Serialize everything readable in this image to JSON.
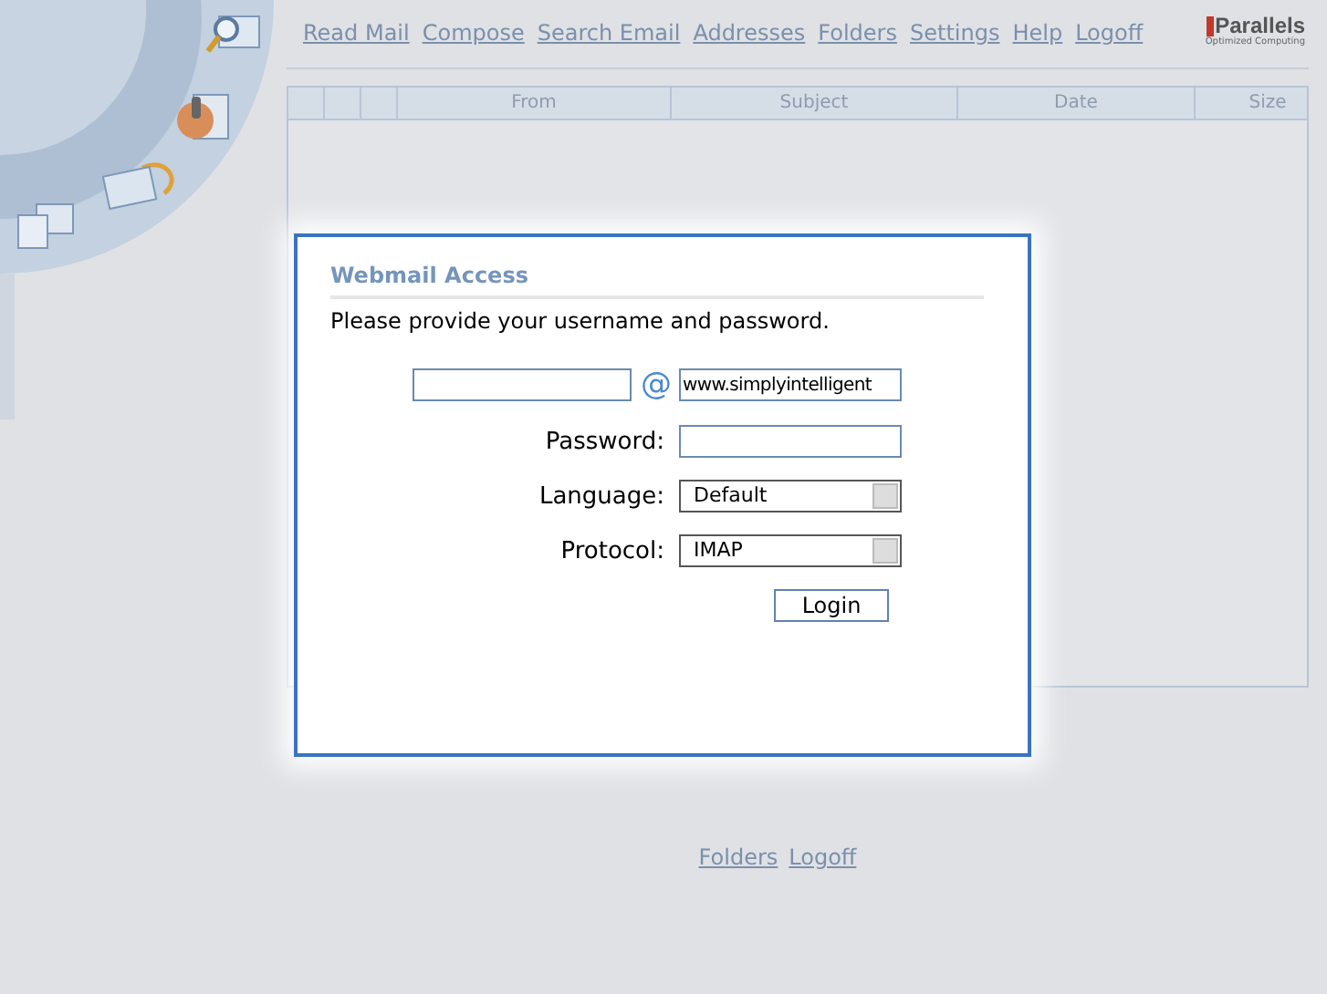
{
  "nav": {
    "links": [
      "Read Mail",
      "Compose",
      "Search Email",
      "Addresses",
      "Folders",
      "Settings",
      "Help",
      "Logoff"
    ]
  },
  "logo": {
    "name": "Parallels",
    "tagline": "Optimized Computing"
  },
  "table": {
    "columns": [
      "",
      "",
      "",
      "From",
      "Subject",
      "Date",
      "Size"
    ]
  },
  "dialog": {
    "title": "Webmail Access",
    "message": "Please provide your username and password.",
    "at": "@",
    "domain": {
      "value": "www.simplyintelligent"
    },
    "password": {
      "label": "Password:"
    },
    "language": {
      "label": "Language:",
      "value": "Default"
    },
    "protocol": {
      "label": "Protocol:",
      "value": "IMAP"
    },
    "button": "Login"
  },
  "footer": {
    "links": [
      "Folders",
      "Logoff"
    ]
  }
}
